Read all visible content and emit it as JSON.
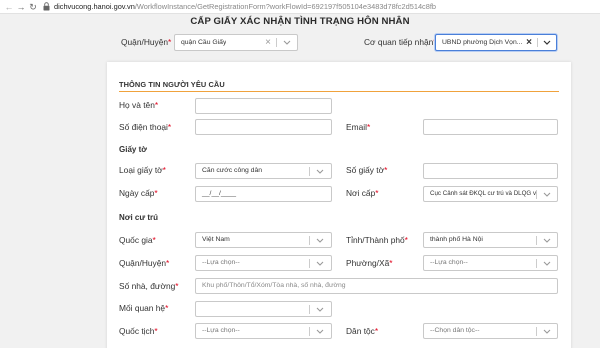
{
  "browser": {
    "url_host": "dichvucong.hanoi.gov.vn",
    "url_path": "/WorkflowInstance/GetRegistrationForm?workFlowId=692197f505104e3483d78fc2d514c8fb"
  },
  "header": {
    "title": "CẤP GIẤY XÁC NHẬN TÌNH TRẠNG HÔN NHÂN",
    "district_label": "Quận/Huyện",
    "district_value": "quận Cầu Giấy",
    "agency_label": "Cơ quan tiếp nhận",
    "agency_value": "UBND phường Dịch Vọn..."
  },
  "required_mark": "*",
  "form": {
    "section_title": "THÔNG TIN NGƯỜI YÊU CẦU",
    "ho_ten_label": "Họ và tên",
    "so_dien_thoai_label": "Số điện thoại",
    "email_label": "Email",
    "giay_to_heading": "Giấy tờ",
    "loai_giay_to_label": "Loại giấy tờ",
    "loai_giay_to_value": "Căn cước công dân",
    "so_giay_to_label": "Số giấy tờ",
    "ngay_cap_label": "Ngày cấp",
    "ngay_cap_placeholder": "__/__/____",
    "noi_cap_label": "Nơi cấp",
    "noi_cap_value": "Cục Cảnh sát ĐKQL cư trú và DLQG v...",
    "noi_cu_tru_heading": "Nơi cư trú",
    "quoc_gia_label": "Quốc gia",
    "quoc_gia_value": "Việt Nam",
    "tinh_thanh_label": "Tỉnh/Thành phố",
    "tinh_thanh_value": "thành phố Hà Nội",
    "quan_huyen_label": "Quận/Huyện",
    "quan_huyen_placeholder": "--Lựa chọn--",
    "phuong_xa_label": "Phường/Xã",
    "phuong_xa_placeholder": "--Lựa chọn--",
    "so_nha_label": "Số nhà, đường",
    "so_nha_placeholder": "Khu phố/Thôn/Tổ/Xóm/Tòa nhà, số nhà, đường",
    "moi_quan_he_label": "Mối quan hệ",
    "quoc_tich_label": "Quốc tịch",
    "quoc_tich_placeholder": "--Lựa chọn--",
    "dan_toc_label": "Dân tộc",
    "dan_toc_placeholder": "--Chọn dân tộc--"
  },
  "colors": {
    "required": "#e0001a",
    "section_rule": "#f0a23c",
    "focus_border": "#4a7fd8"
  }
}
